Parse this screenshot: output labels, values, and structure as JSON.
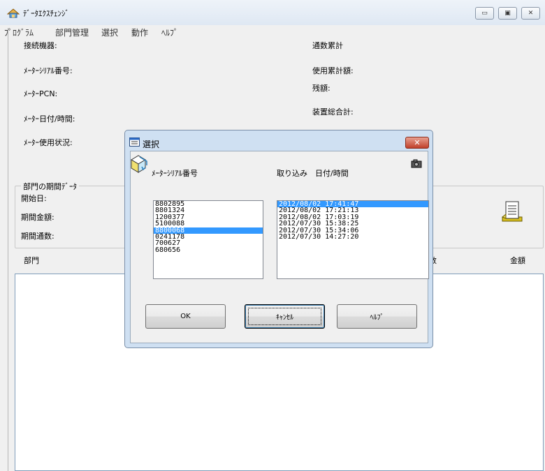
{
  "window": {
    "title": "ﾃﾞｰﾀｴｸｽﾁｪﾝｼﾞ",
    "min_glyph": "▭",
    "max_glyph": "▣",
    "close_glyph": "✕"
  },
  "menu": {
    "items": [
      "ﾌﾟﾛｸﾞﾗﾑ",
      "部門管理",
      "選択",
      "動作",
      "ﾍﾙﾌﾟ"
    ]
  },
  "main": {
    "left_labels": [
      "接続機器:",
      "ﾒｰﾀｰｼﾘｱﾙ番号:",
      "ﾒｰﾀｰPCN:",
      "ﾒｰﾀｰ日付/時間:",
      "ﾒｰﾀｰ使用状況:"
    ],
    "right_labels": [
      "通数累計",
      "使用累計額:",
      "残額:",
      "装置総合計:"
    ],
    "group_title": "部門の期間ﾃﾞｰﾀ",
    "period_labels": [
      "開始日:",
      "期間金額:",
      "期間通数:"
    ],
    "col_dept": "部門",
    "col_count": "数",
    "col_amount": "金額"
  },
  "dialog": {
    "title": "選択",
    "close_glyph": "✕",
    "serial_header": "ﾒｰﾀｰｼﾘｱﾙ番号",
    "capture_header": "取り込み　日付/時間",
    "serials": [
      "8802895",
      "8801324",
      "1200377",
      "5100088",
      "8800068",
      "0241178",
      "700627",
      "680656"
    ],
    "selected_serial_index": 4,
    "datetimes": [
      "2012/08/02 17:41:47",
      "2012/08/02 17:21:13",
      "2012/08/02 17:03:19",
      "2012/07/30 15:38:25",
      "2012/07/30 15:34:06",
      "2012/07/30 14:27:20"
    ],
    "selected_datetime_index": 0,
    "ok_label": "OK",
    "cancel_label": "ｷｬﾝｾﾙ",
    "help_label": "ﾍﾙﾌﾟ"
  },
  "colors": {
    "selection": "#3399ff",
    "dialog_frame": "#cfe0f2"
  }
}
